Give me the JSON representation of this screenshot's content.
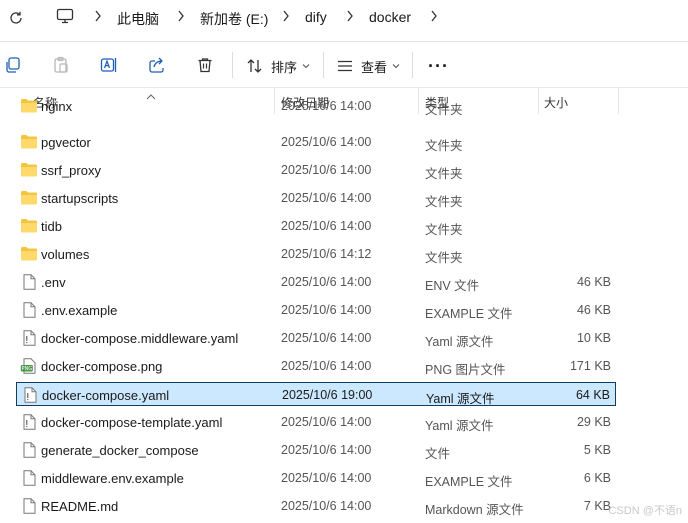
{
  "address": {
    "crumbs": [
      "此电脑",
      "新加卷 (E:)",
      "dify",
      "docker"
    ]
  },
  "toolbar": {
    "sort_label": "排序",
    "view_label": "查看",
    "more_label": "···"
  },
  "columns": {
    "name": "名称",
    "modified": "修改日期",
    "type": "类型",
    "size": "大小"
  },
  "files": [
    {
      "name": "nginx",
      "date": "2025/10/6 14:00",
      "type": "文件夹",
      "size": "",
      "icon": "folder"
    },
    {
      "name": "pgvector",
      "date": "2025/10/6 14:00",
      "type": "文件夹",
      "size": "",
      "icon": "folder"
    },
    {
      "name": "ssrf_proxy",
      "date": "2025/10/6 14:00",
      "type": "文件夹",
      "size": "",
      "icon": "folder"
    },
    {
      "name": "startupscripts",
      "date": "2025/10/6 14:00",
      "type": "文件夹",
      "size": "",
      "icon": "folder"
    },
    {
      "name": "tidb",
      "date": "2025/10/6 14:00",
      "type": "文件夹",
      "size": "",
      "icon": "folder"
    },
    {
      "name": "volumes",
      "date": "2025/10/6 14:12",
      "type": "文件夹",
      "size": "",
      "icon": "folder"
    },
    {
      "name": ".env",
      "date": "2025/10/6 14:00",
      "type": "ENV 文件",
      "size": "46 KB",
      "icon": "file"
    },
    {
      "name": ".env.example",
      "date": "2025/10/6 14:00",
      "type": "EXAMPLE 文件",
      "size": "46 KB",
      "icon": "file"
    },
    {
      "name": "docker-compose.middleware.yaml",
      "date": "2025/10/6 14:00",
      "type": "Yaml 源文件",
      "size": "10 KB",
      "icon": "yaml"
    },
    {
      "name": "docker-compose.png",
      "date": "2025/10/6 14:00",
      "type": "PNG 图片文件",
      "size": "171 KB",
      "icon": "png"
    },
    {
      "name": "docker-compose.yaml",
      "date": "2025/10/6 19:00",
      "type": "Yaml 源文件",
      "size": "64 KB",
      "icon": "yaml",
      "selected": true
    },
    {
      "name": "docker-compose-template.yaml",
      "date": "2025/10/6 14:00",
      "type": "Yaml 源文件",
      "size": "29 KB",
      "icon": "yaml"
    },
    {
      "name": "generate_docker_compose",
      "date": "2025/10/6 14:00",
      "type": "文件",
      "size": "5 KB",
      "icon": "file"
    },
    {
      "name": "middleware.env.example",
      "date": "2025/10/6 14:00",
      "type": "EXAMPLE 文件",
      "size": "6 KB",
      "icon": "file"
    },
    {
      "name": "README.md",
      "date": "2025/10/6 14:00",
      "type": "Markdown 源文件",
      "size": "7 KB",
      "icon": "file"
    }
  ],
  "watermark": "CSDN @不语n",
  "colors": {
    "folder": "#f5c542",
    "selection": "#cce8ff",
    "selection_border": "#0f3d66"
  }
}
